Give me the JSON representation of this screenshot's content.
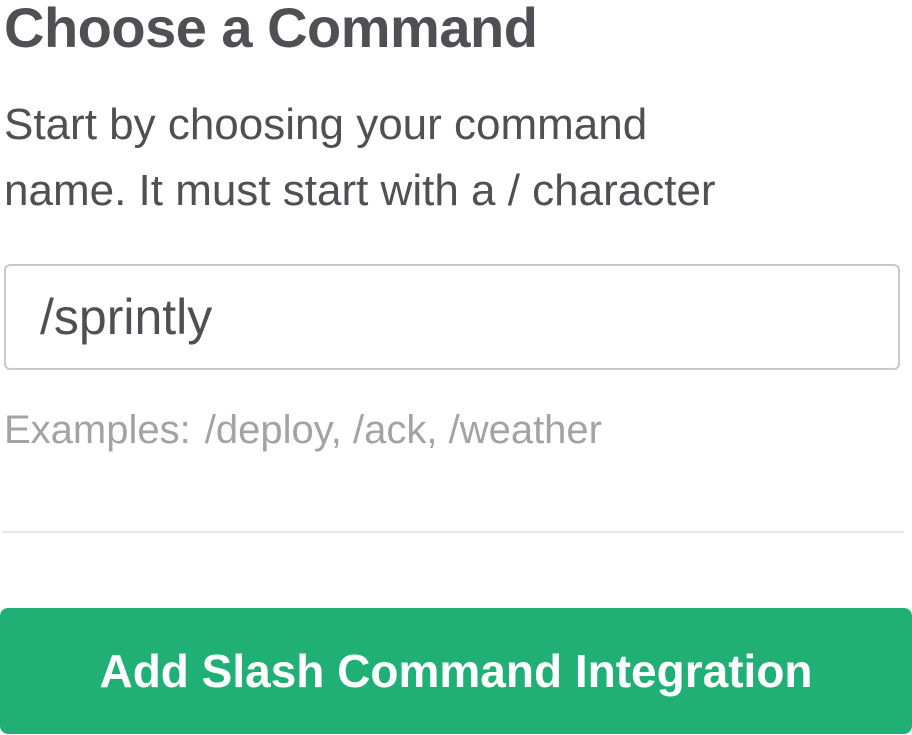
{
  "header": {
    "title": "Choose a Command"
  },
  "description": {
    "line1": "Start by choosing your command",
    "line2": "name. It must start with a / character"
  },
  "command_input": {
    "value": "/sprintly"
  },
  "examples": {
    "label": "Examples:",
    "values": "/deploy, /ack, /weather"
  },
  "actions": {
    "add_button_label": "Add Slash Command Integration"
  },
  "colors": {
    "button_background": "#20b075",
    "button_text": "#ffffff",
    "text_primary": "#505054",
    "text_muted": "#a3a3a6",
    "input_border": "#c9c9cb",
    "divider": "#e6e6e7"
  }
}
